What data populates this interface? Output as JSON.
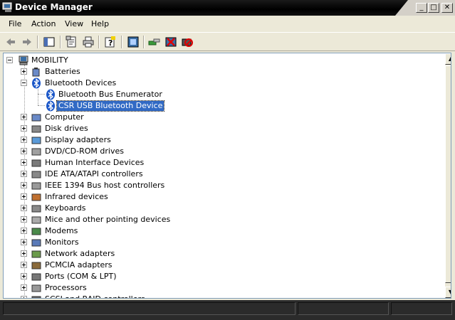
{
  "window": {
    "title": "Device Manager"
  },
  "caption_buttons": {
    "minimize": "_",
    "maximize": "□",
    "close": "✕"
  },
  "menu": {
    "items": [
      "File",
      "Action",
      "View",
      "Help"
    ]
  },
  "toolbar": {
    "buttons": [
      "back-icon",
      "forward-icon",
      "console-tree-icon",
      "properties-icon",
      "print-icon",
      "help-icon",
      "scan-hardware-icon",
      "update-driver-icon",
      "uninstall-icon",
      "disable-icon"
    ]
  },
  "tree": {
    "root": "MOBILITY",
    "categories": [
      {
        "label": "Batteries",
        "expanded": false
      },
      {
        "label": "Bluetooth Devices",
        "expanded": true,
        "children": [
          "Bluetooth Bus Enumerator",
          "CSR USB Bluetooth Device"
        ]
      },
      {
        "label": "Computer",
        "expanded": false
      },
      {
        "label": "Disk drives",
        "expanded": false
      },
      {
        "label": "Display adapters",
        "expanded": false
      },
      {
        "label": "DVD/CD-ROM drives",
        "expanded": false
      },
      {
        "label": "Human Interface Devices",
        "expanded": false
      },
      {
        "label": "IDE ATA/ATAPI controllers",
        "expanded": false
      },
      {
        "label": "IEEE 1394 Bus host controllers",
        "expanded": false
      },
      {
        "label": "Infrared devices",
        "expanded": false
      },
      {
        "label": "Keyboards",
        "expanded": false
      },
      {
        "label": "Mice and other pointing devices",
        "expanded": false
      },
      {
        "label": "Modems",
        "expanded": false
      },
      {
        "label": "Monitors",
        "expanded": false
      },
      {
        "label": "Network adapters",
        "expanded": false
      },
      {
        "label": "PCMCIA adapters",
        "expanded": false
      },
      {
        "label": "Ports (COM & LPT)",
        "expanded": false
      },
      {
        "label": "Processors",
        "expanded": false
      },
      {
        "label": "SCSI and RAID controllers",
        "expanded": false
      }
    ],
    "selected": "CSR USB Bluetooth Device"
  },
  "colors": {
    "selection": "#316ac5",
    "titlebar": "#000000",
    "chrome": "#ece9d8"
  }
}
